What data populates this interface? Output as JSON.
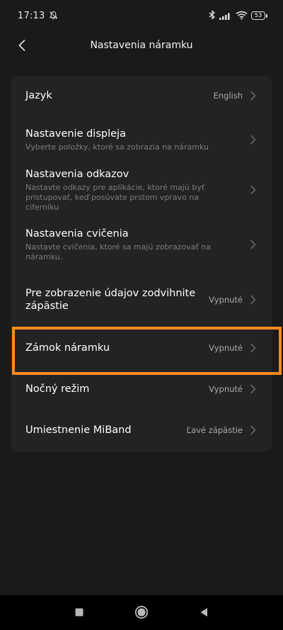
{
  "status_bar": {
    "time": "17:13",
    "battery_level": "53"
  },
  "header": {
    "title": "Nastavenia náramku"
  },
  "settings": [
    {
      "title": "Jazyk",
      "subtitle": "",
      "value": "English"
    },
    {
      "title": "Nastavenie displeja",
      "subtitle": "Vyberte položky, ktoré sa zobrazia na náramku",
      "value": ""
    },
    {
      "title": "Nastavenia odkazov",
      "subtitle": "Nastavte odkazy pre aplikácie, ktoré majú byť pristupovať, keď posúvate prstom vpravo na ciferníku",
      "value": ""
    },
    {
      "title": "Nastavenia cvičenia",
      "subtitle": "Nastavte cvičenia, ktoré sa majú zobrazovať na náramku.",
      "value": ""
    },
    {
      "title": "Pre zobrazenie údajov zodvihnite zápästie",
      "subtitle": "",
      "value": "Vypnuté"
    },
    {
      "title": "Zámok náramku",
      "subtitle": "",
      "value": "Vypnuté"
    },
    {
      "title": "Nočný režim",
      "subtitle": "",
      "value": "Vypnuté"
    },
    {
      "title": "Umiestnenie MiBand",
      "subtitle": "",
      "value": "Ľavé zápästie"
    }
  ],
  "colors": {
    "background": "#1a1a1a",
    "card": "#232323",
    "highlight": "#ff8a1f"
  }
}
